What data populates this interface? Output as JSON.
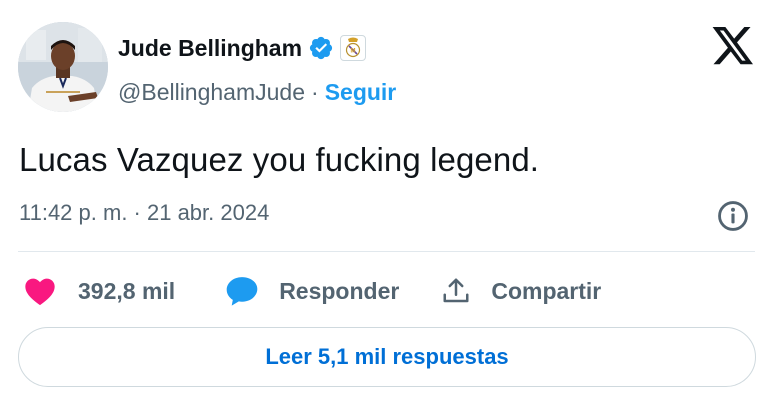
{
  "author": {
    "name": "Jude Bellingham",
    "handle": "@BellinghamJude",
    "separator": "·",
    "follow_label": "Seguir"
  },
  "tweet": {
    "text": "Lucas Vazquez you fucking legend.",
    "timestamp": "11:42 p. m. · 21 abr. 2024"
  },
  "actions": {
    "likes": "392,8 mil",
    "reply_label": "Responder",
    "share_label": "Compartir"
  },
  "read_replies_label": "Leer 5,1 mil respuestas",
  "colors": {
    "accent": "#1d9bf0",
    "like": "#f91880",
    "reply_icon": "#1d9bf0",
    "muted": "#536471"
  },
  "icons": {
    "verified": "verified-badge-icon",
    "affiliation": "real-madrid-crest-icon",
    "brand": "x-logo-icon",
    "info": "info-icon",
    "like": "heart-icon",
    "reply": "speech-bubble-icon",
    "share": "share-upload-icon"
  }
}
